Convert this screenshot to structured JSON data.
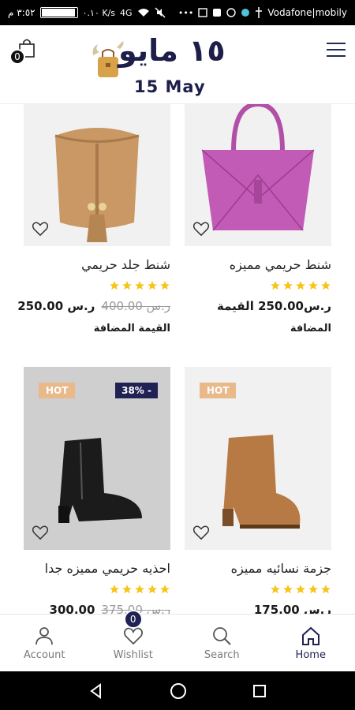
{
  "status_bar": {
    "time": "٣:٥٢ م",
    "carrier": "Vodafone|mobily",
    "data_speed": "٠.١٠ K/s",
    "signal_label": "4G"
  },
  "header": {
    "cart_count": "0",
    "logo_arabic": "١٥ مايو",
    "logo_english": "15 May"
  },
  "products": [
    {
      "name": "شنط حريمي مميزه",
      "rating": 5,
      "price": "ر.س250.00 القيمة",
      "old_price": "",
      "vat": "المضافة",
      "badge_hot": "",
      "badge_sale": ""
    },
    {
      "name": "شنط جلد حريمي",
      "rating": 5,
      "price": "250.00 ر.س",
      "old_price": "400.00 ر.س",
      "vat": "القيمة المضافة",
      "badge_hot": "",
      "badge_sale": ""
    },
    {
      "name": "جزمة نسائيه مميزه",
      "rating": 5,
      "price": "175.00 ر.س",
      "old_price": "",
      "vat": "",
      "badge_hot": "HOT",
      "badge_sale": ""
    },
    {
      "name": "احذيه حريمي مميزه جدا",
      "rating": 5,
      "price": "300.00",
      "old_price": "375.00 ر.س",
      "vat": "",
      "badge_hot": "HOT",
      "badge_sale": "38% -"
    }
  ],
  "bottom_nav": {
    "items": [
      {
        "label": "Account",
        "icon": "user-icon"
      },
      {
        "label": "Wishlist",
        "icon": "heart-icon",
        "badge": "0"
      },
      {
        "label": "Search",
        "icon": "search-icon"
      },
      {
        "label": "Home",
        "icon": "home-icon"
      }
    ],
    "active": "Home"
  },
  "colors": {
    "brand_navy": "#1f2252",
    "hot_badge": "#e9b98a",
    "star": "#f5c518"
  }
}
